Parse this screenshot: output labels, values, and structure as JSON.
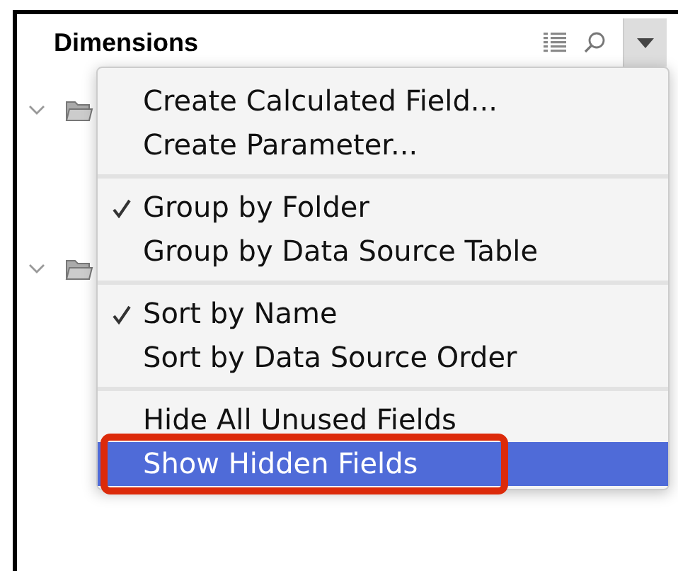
{
  "panel": {
    "title": "Dimensions"
  },
  "tree": [
    {
      "expanded": true
    },
    {
      "expanded": true
    }
  ],
  "menu": {
    "groups": [
      {
        "items": [
          {
            "label": "Create Calculated Field...",
            "checked": false,
            "selected": false
          },
          {
            "label": "Create Parameter...",
            "checked": false,
            "selected": false
          }
        ]
      },
      {
        "items": [
          {
            "label": "Group by Folder",
            "checked": true,
            "selected": false
          },
          {
            "label": "Group by Data Source Table",
            "checked": false,
            "selected": false
          }
        ]
      },
      {
        "items": [
          {
            "label": "Sort by Name",
            "checked": true,
            "selected": false
          },
          {
            "label": "Sort by Data Source Order",
            "checked": false,
            "selected": false
          }
        ]
      },
      {
        "items": [
          {
            "label": "Hide All Unused Fields",
            "checked": false,
            "selected": false
          },
          {
            "label": "Show Hidden Fields",
            "checked": false,
            "selected": true,
            "outlined": true
          }
        ]
      }
    ]
  }
}
